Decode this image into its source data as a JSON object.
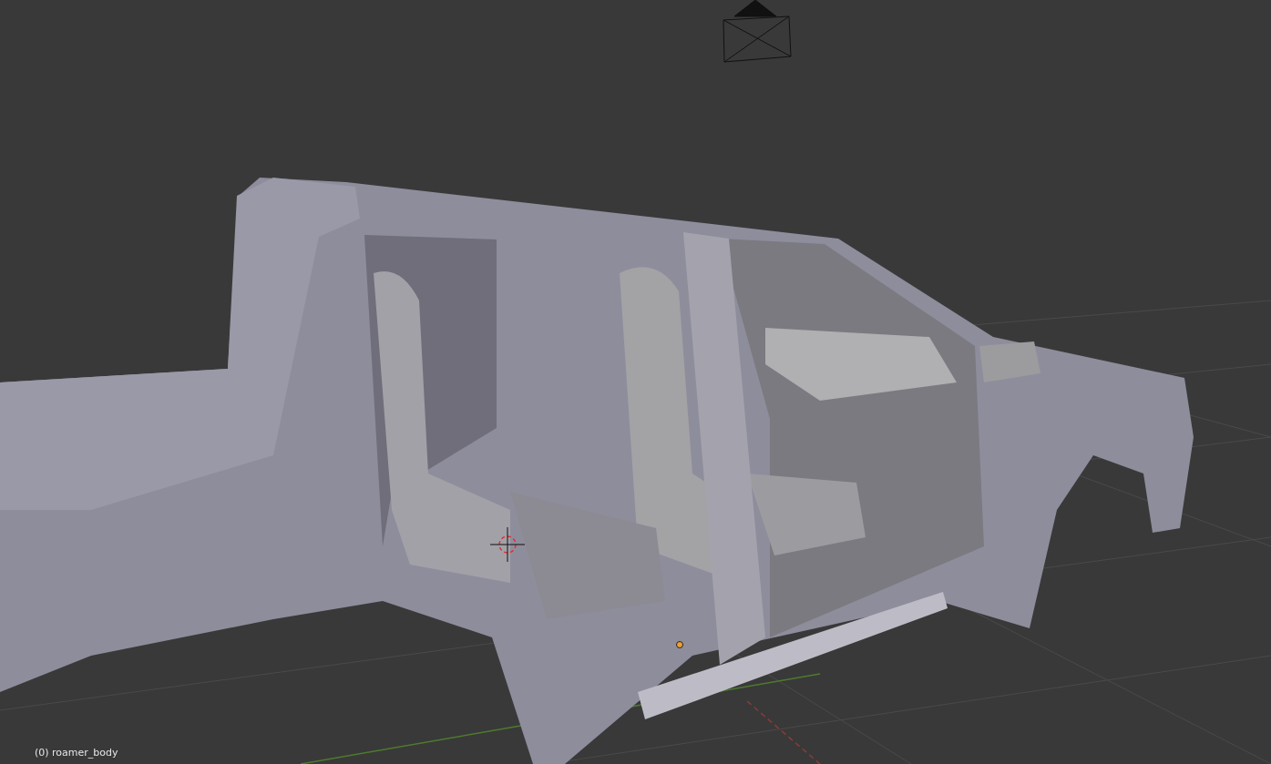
{
  "viewport": {
    "object_label": "(0) roamer_body"
  }
}
